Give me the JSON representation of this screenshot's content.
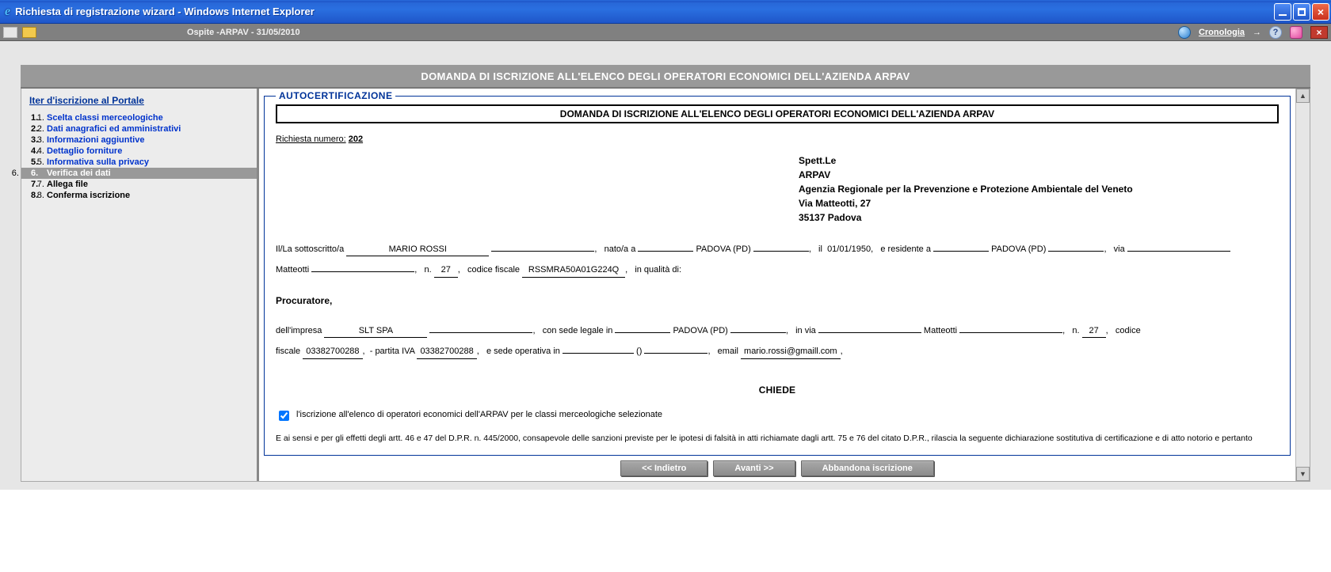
{
  "window": {
    "title": "Richiesta di registrazione wizard - Windows Internet Explorer"
  },
  "toolbar": {
    "center": "Ospite -ARPAV - 31/05/2010",
    "cronologia": "Cronologia"
  },
  "header": {
    "title": "DOMANDA DI ISCRIZIONE ALL'ELENCO DEGLI OPERATORI ECONOMICI DELL'AZIENDA ARPAV"
  },
  "sidebar": {
    "title": "Iter d'iscrizione al Portale",
    "items": [
      {
        "num": "1.",
        "label": "Scelta classi merceologiche",
        "state": "link"
      },
      {
        "num": "2.",
        "label": "Dati anagrafici ed amministrativi",
        "state": "link"
      },
      {
        "num": "3.",
        "label": "Informazioni aggiuntive",
        "state": "link"
      },
      {
        "num": "4.",
        "label": "Dettaglio forniture",
        "state": "link"
      },
      {
        "num": "5.",
        "label": "Informativa sulla privacy",
        "state": "link"
      },
      {
        "num": "6.",
        "label": "Verifica dei dati",
        "state": "active"
      },
      {
        "num": "7.",
        "label": "Allega file",
        "state": "disabled"
      },
      {
        "num": "8.",
        "label": "Conferma iscrizione",
        "state": "disabled"
      }
    ]
  },
  "doc": {
    "legend": "AUTOCERTIFICAZIONE",
    "title": "DOMANDA DI ISCRIZIONE ALL'ELENCO DEGLI OPERATORI ECONOMICI DELL'AZIENDA ARPAV",
    "request_label": "Richiesta numero:",
    "request_no": "202",
    "recipient": {
      "line1": "Spett.Le",
      "line2": "ARPAV",
      "line3": "Agenzia Regionale per la Prevenzione e Protezione Ambientale del Veneto",
      "line4": "Via Matteotti, 27",
      "line5": "35137 Padova"
    },
    "person": {
      "intro": "Il/La sottoscritto/a",
      "name": "MARIO ROSSI",
      "born_label": "nato/a a",
      "born_city": "PADOVA  (PD)",
      "born_date_label": "il",
      "born_date": "01/01/1950,",
      "resident_label": "e residente a",
      "resident_city": "PADOVA  (PD)",
      "via_label": "via",
      "street": "Matteotti",
      "num_label": "n.",
      "num": "27",
      "cf_label": "codice fiscale",
      "cf": "RSSMRA50A01G224Q",
      "quality_label": "in qualità di:"
    },
    "role": "Procuratore",
    "company": {
      "intro": "dell'impresa",
      "name": "SLT  SPA",
      "sede_label": "con  sede  legale  in",
      "sede_city": "PADOVA  (PD)",
      "via_label": "in  via",
      "street": "Matteotti",
      "num_label": "n.",
      "num": "27",
      "cf_label": "codice fiscale",
      "cf": "03382700288",
      "piva_label": "- partita IVA",
      "piva": "03382700288",
      "sede_op_label": "e sede operativa in",
      "sede_op_city": "",
      "sede_op_prov": "()",
      "email_label": "email",
      "email": "mario.rossi@gmaill.com"
    },
    "chiede": "CHIEDE",
    "chk_text": "l'iscrizione all'elenco di operatori economici dell'ARPAV per le classi merceologiche selezionate",
    "legal": "E ai sensi e per gli effetti degli artt. 46 e 47 del D.P.R. n. 445/2000, consapevole delle sanzioni previste per le ipotesi di falsità in atti richiamate dagli artt. 75 e 76 del citato D.P.R., rilascia la seguente dichiarazione sostitutiva di certificazione e di atto notorio e pertanto"
  },
  "buttons": {
    "back": "<< Indietro",
    "next": "Avanti >>",
    "abort": "Abbandona iscrizione"
  }
}
